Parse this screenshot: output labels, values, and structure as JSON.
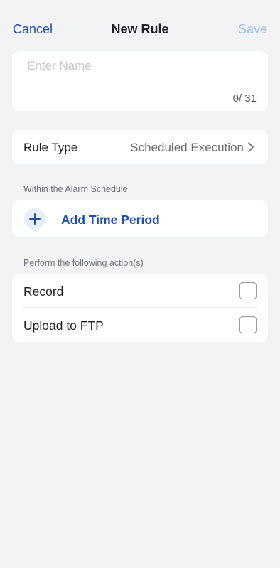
{
  "nav": {
    "cancel_label": "Cancel",
    "title": "New Rule",
    "save_label": "Save"
  },
  "name_field": {
    "placeholder": "Enter Name",
    "value": "",
    "counter": "0/ 31"
  },
  "rule_type": {
    "label": "Rule Type",
    "value": "Scheduled Execution"
  },
  "schedule_section": {
    "header": "Within the Alarm Schedule",
    "add_label": "Add Time Period"
  },
  "actions_section": {
    "header": "Perform the following action(s)",
    "items": [
      {
        "label": "Record",
        "checked": false
      },
      {
        "label": "Upload to FTP",
        "checked": false
      }
    ]
  },
  "colors": {
    "accent": "#1f4fa6",
    "save_disabled": "#9fbde8",
    "background": "#f2f3f5"
  },
  "icons": {
    "add": "plus-icon",
    "disclosure": "chevron-right-icon"
  }
}
